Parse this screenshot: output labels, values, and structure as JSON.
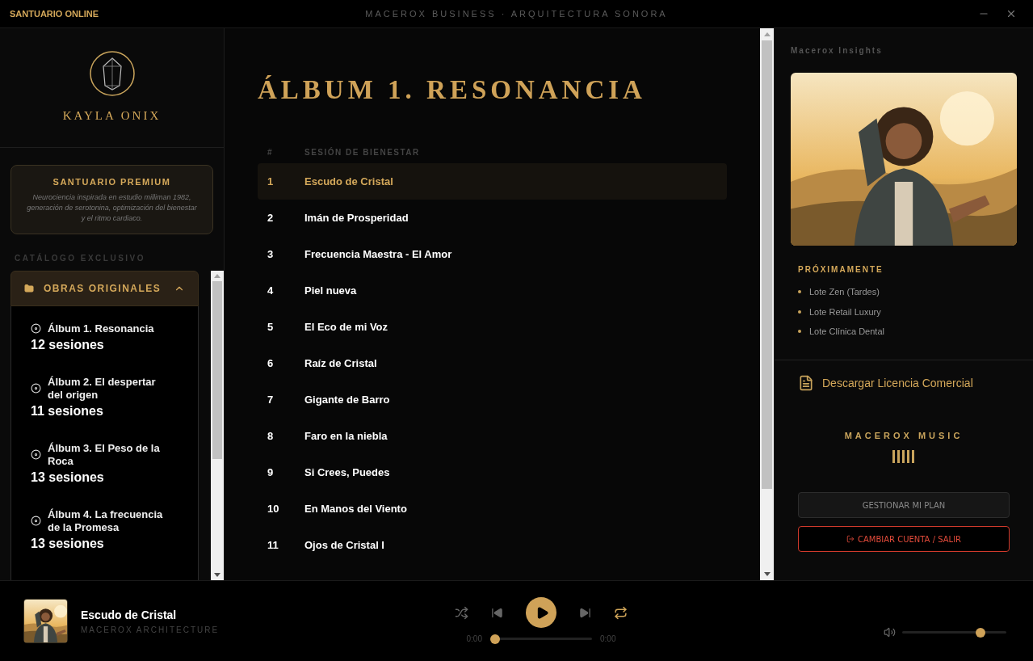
{
  "titlebar": {
    "app_name": "SANTUARIO ONLINE",
    "title": "MACEROX BUSINESS · ARQUITECTURA SONORA"
  },
  "sidebar": {
    "artist": "KAYLA ONIX",
    "premium": {
      "title": "SANTUARIO PREMIUM",
      "text": "Neurociencia inspirada en estudio milliman 1982, generación de serotonina, optimización del bienestar y el ritmo cardiaco."
    },
    "catalog_label": "CATÁLOGO EXCLUSIVO",
    "folder": {
      "label": "OBRAS ORIGINALES",
      "expanded": true
    },
    "albums": [
      {
        "title": "Álbum 1. Resonancia",
        "sessions": "12 sesiones"
      },
      {
        "title": "Álbum 2. El despertar del origen",
        "sessions": "11 sesiones"
      },
      {
        "title": "Álbum 3. El Peso de la Roca",
        "sessions": "13 sesiones"
      },
      {
        "title": "Álbum 4. La frecuencia de la Promesa",
        "sessions": "13 sesiones"
      }
    ]
  },
  "main": {
    "title": "ÁLBUM 1. RESONANCIA",
    "columns": [
      "#",
      "SESIÓN DE BIENESTAR"
    ],
    "tracks": [
      {
        "number": "1",
        "title": "Escudo de Cristal",
        "selected": true
      },
      {
        "number": "2",
        "title": "Imán de Prosperidad",
        "selected": false
      },
      {
        "number": "3",
        "title": "Frecuencia Maestra - El Amor",
        "selected": false
      },
      {
        "number": "4",
        "title": "Piel nueva",
        "selected": false
      },
      {
        "number": "5",
        "title": "El Eco de mi Voz",
        "selected": false
      },
      {
        "number": "6",
        "title": "Raíz de Cristal",
        "selected": false
      },
      {
        "number": "7",
        "title": "Gigante de Barro",
        "selected": false
      },
      {
        "number": "8",
        "title": "Faro en la niebla",
        "selected": false
      },
      {
        "number": "9",
        "title": "Si Crees, Puedes",
        "selected": false
      },
      {
        "number": "10",
        "title": "En Manos del Viento",
        "selected": false
      },
      {
        "number": "11",
        "title": "Ojos de Cristal I",
        "selected": false
      }
    ]
  },
  "insights": {
    "title": "Macerox Insights",
    "upcoming_title": "PRÓXIMAMENTE",
    "upcoming": [
      "Lote Zen (Tardes)",
      "Lote Retail Luxury",
      "Lote Clínica Dental"
    ],
    "license_link": "Descargar Licencia Comercial",
    "brand": "MACEROX MUSIC",
    "buttons": [
      {
        "label": "GESTIONAR MI PLAN",
        "kind": "secondary"
      },
      {
        "label": "CAMBIAR CUENTA / SALIR",
        "kind": "danger"
      }
    ]
  },
  "player": {
    "title": "Escudo de Cristal",
    "artist": "MACEROX ARCHITECTURE",
    "shuffle": false,
    "repeat": true,
    "elapsed": "0:00",
    "duration": "0:00",
    "progress": {
      "level": 0
    },
    "volume": {
      "level": 0.78
    }
  }
}
